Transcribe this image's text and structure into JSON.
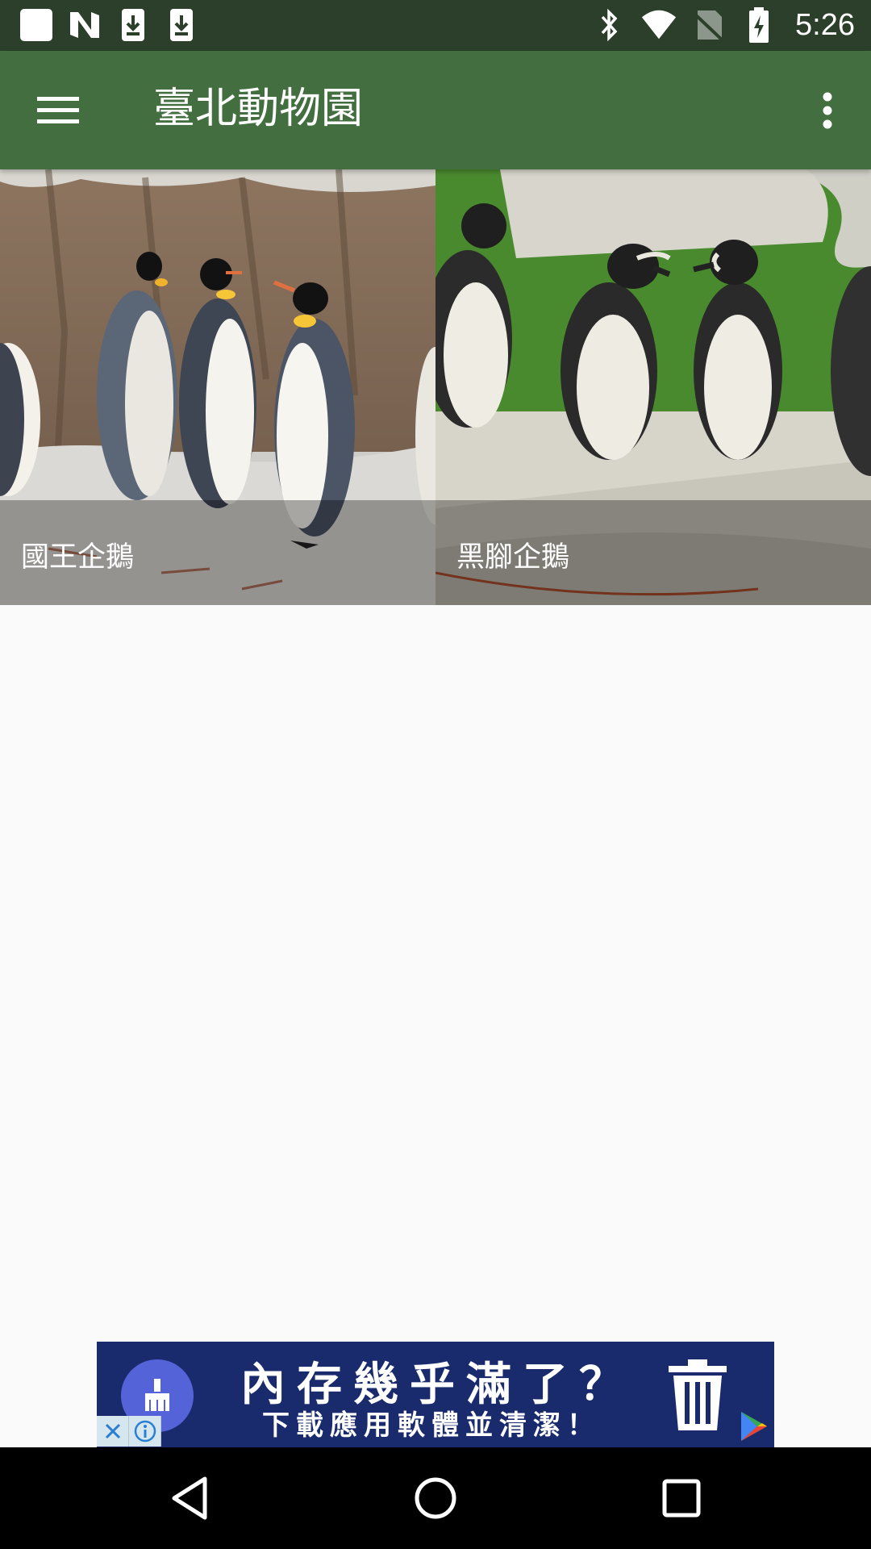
{
  "status_bar": {
    "time": "5:26",
    "left_icons": [
      "square-notification-icon",
      "n-logo-icon",
      "download-icon",
      "download-icon"
    ],
    "right_icons": [
      "bluetooth-icon",
      "wifi-icon",
      "no-sim-icon",
      "battery-charging-icon"
    ]
  },
  "app_bar": {
    "title": "臺北動物園",
    "background_color": "#436e3f"
  },
  "grid": {
    "items": [
      {
        "label": "國王企鵝",
        "image": "king-penguins-photo"
      },
      {
        "label": "黑腳企鵝",
        "image": "african-penguins-photo"
      }
    ]
  },
  "ad": {
    "line1": "內存幾乎滿了？",
    "line2": "下載應用軟體並清潔！"
  },
  "nav_bar": {
    "buttons": [
      "back",
      "home",
      "recents"
    ]
  }
}
